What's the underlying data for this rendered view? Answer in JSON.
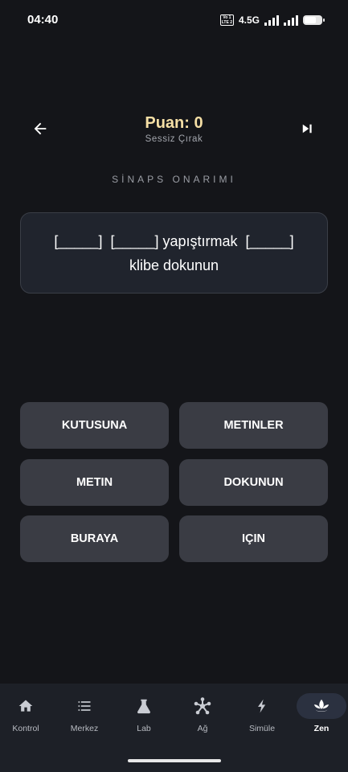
{
  "status_bar": {
    "time": "04:40",
    "volte_top": "Vo 1",
    "volte_bottom": "LTE 2",
    "network": "4.5G"
  },
  "header": {
    "score": "Puan: 0",
    "rank": "Sessiz Çırak",
    "icons": {
      "back": "arrow-left-icon",
      "skip": "skip-next-icon"
    }
  },
  "section_title": "SİNAPS ONARIMI",
  "prompt": {
    "line1": "[_____]  [_____] yapıştırmak  [_____]",
    "line2": "klibe dokunun"
  },
  "answers": [
    {
      "label": "KUTUSUNA"
    },
    {
      "label": "METINLER"
    },
    {
      "label": "METIN"
    },
    {
      "label": "DOKUNUN"
    },
    {
      "label": "BURAYA"
    },
    {
      "label": "IÇIN"
    }
  ],
  "nav": {
    "items": [
      {
        "label": "Kontrol",
        "icon": "home-icon"
      },
      {
        "label": "Merkez",
        "icon": "list-icon"
      },
      {
        "label": "Lab",
        "icon": "flask-icon"
      },
      {
        "label": "Ağ",
        "icon": "network-icon"
      },
      {
        "label": "Simüle",
        "icon": "bolt-icon"
      },
      {
        "label": "Zen",
        "icon": "lotus-icon"
      }
    ],
    "active": "Zen"
  },
  "colors": {
    "background": "#141519",
    "score": "#f5dfa5",
    "card": "#20242d",
    "button": "#3a3c44",
    "nav_bg": "#1d2027",
    "nav_active": "#2b3140"
  }
}
